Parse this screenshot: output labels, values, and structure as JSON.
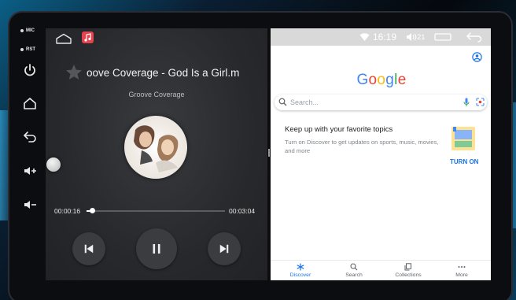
{
  "side_buttons": {
    "mic_label": "MIC",
    "rst_label": "RST",
    "icons": [
      "power-icon",
      "home-icon",
      "back-icon",
      "volume-up-icon",
      "volume-down-icon"
    ]
  },
  "music": {
    "song_title": "oove Coverage - God Is a Girl.m",
    "artist": "Groove Coverage",
    "current_time": "00:00:16",
    "total_time": "00:03:04",
    "progress_fraction": 0.041,
    "accent_color": "#e8424f"
  },
  "google": {
    "status": {
      "time": "16:19",
      "volume": "21"
    },
    "logo": [
      {
        "ch": "G",
        "color": "#4285F4"
      },
      {
        "ch": "o",
        "color": "#EA4335"
      },
      {
        "ch": "o",
        "color": "#FBBC05"
      },
      {
        "ch": "g",
        "color": "#4285F4"
      },
      {
        "ch": "l",
        "color": "#34A853"
      },
      {
        "ch": "e",
        "color": "#EA4335"
      }
    ],
    "search_placeholder": "Search...",
    "card": {
      "heading": "Keep up with your favorite topics",
      "body": "Turn on Discover to get updates on sports, music, movies, and more",
      "action": "TURN ON"
    },
    "nav": [
      {
        "label": "Discover",
        "icon": "asterisk-icon",
        "active": true
      },
      {
        "label": "Search",
        "icon": "search-icon",
        "active": false
      },
      {
        "label": "Collections",
        "icon": "collections-icon",
        "active": false
      },
      {
        "label": "More",
        "icon": "more-icon",
        "active": false
      }
    ],
    "accent_color": "#1a73e8"
  }
}
